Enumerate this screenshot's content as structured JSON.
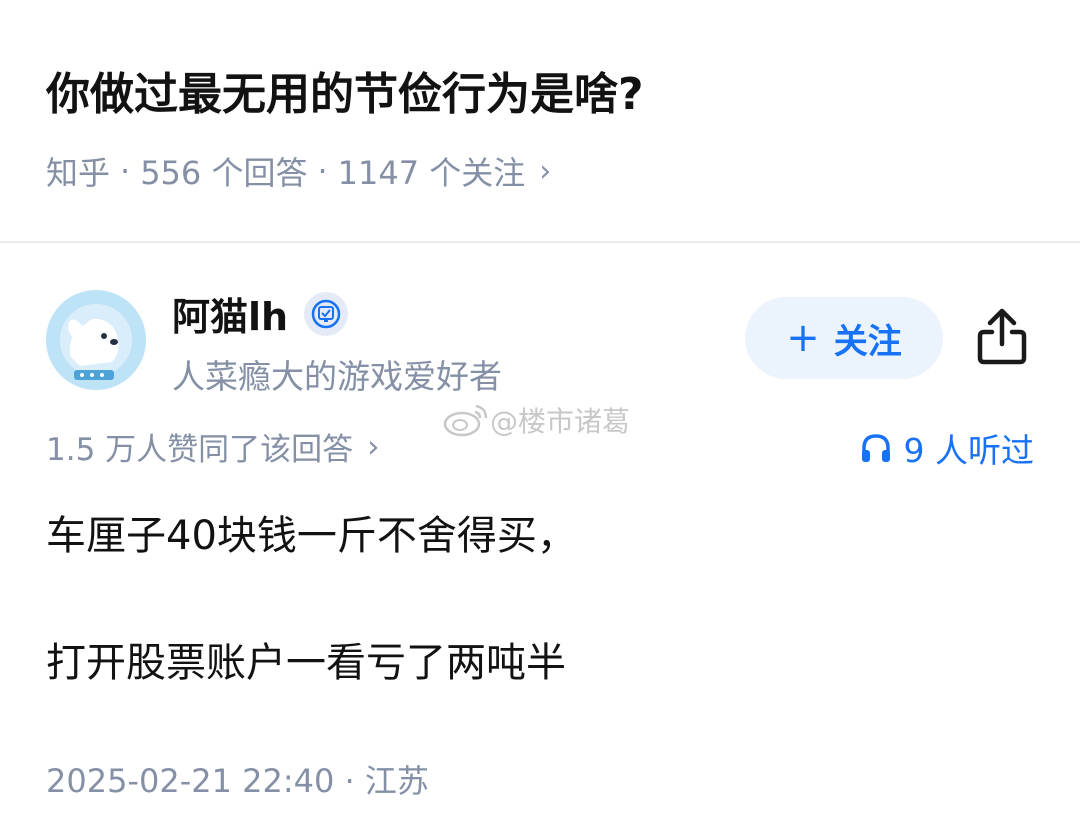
{
  "question": {
    "title": "你做过最无用的节俭行为是啥?"
  },
  "meta": {
    "source": "知乎",
    "separator": "·",
    "answers": "556 个回答",
    "followers": "1147 个关注",
    "chevron": "›"
  },
  "author": {
    "name": "阿猫lh",
    "bio": "人菜瘾大的游戏爱好者",
    "avatar_icon": "dog-avatar-icon",
    "badge_icon": "verified-badge-icon"
  },
  "actions": {
    "follow_plus": "+",
    "follow_label": "关注",
    "share_icon": "share-icon"
  },
  "watermark": {
    "text": "@楼市诸葛"
  },
  "answer": {
    "likes": "1.5 万人赞同了该回答",
    "likes_chevron": "›",
    "listened": "9 人听过",
    "paragraphs": [
      "车厘子40块钱一斤不舍得买，",
      "打开股票账户一看亏了两吨半"
    ],
    "timestamp": "2025-02-21 22:40 · 江苏"
  },
  "colors": {
    "accent": "#1772f6",
    "follow_bg": "#ebf3fd",
    "muted_text": "#8590a6",
    "divider": "#ebebeb"
  }
}
